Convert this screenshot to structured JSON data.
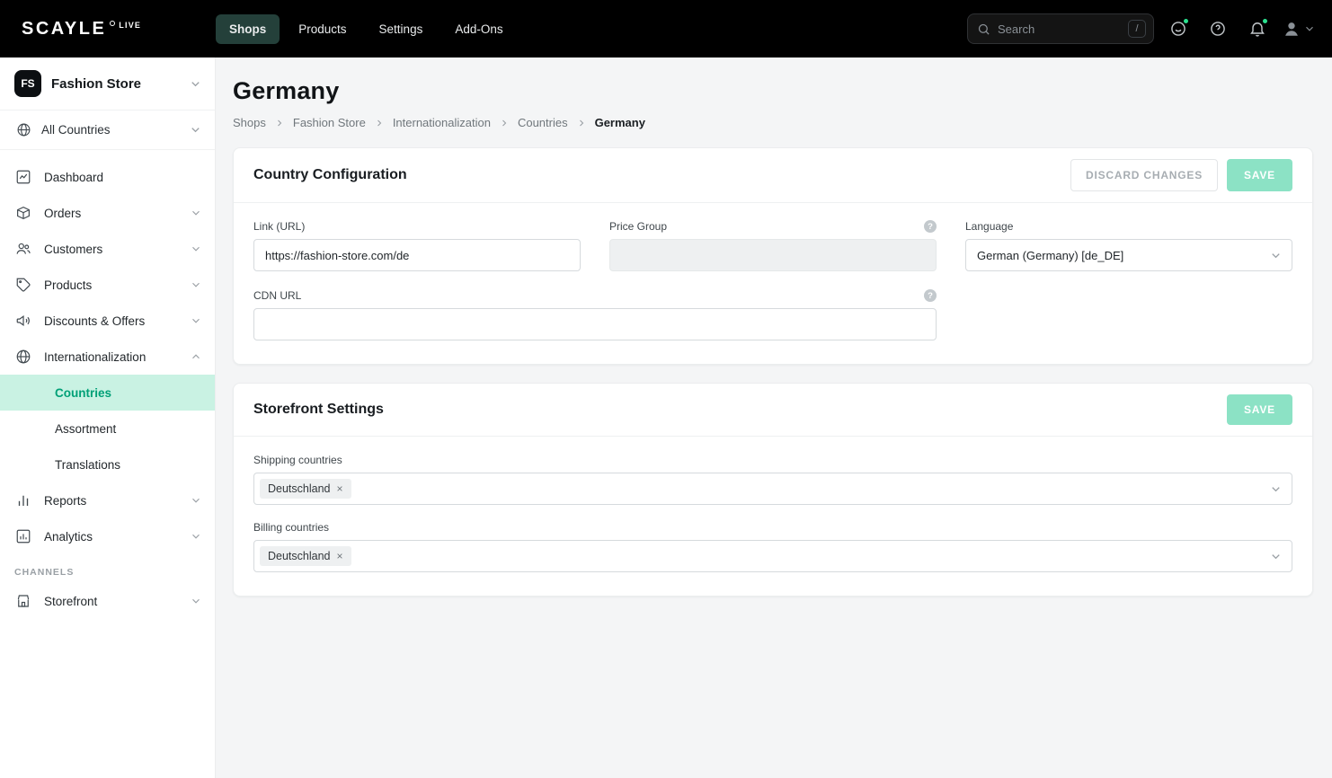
{
  "topbar": {
    "logo": "SCAYLE",
    "env_badge": "LIVE",
    "nav": [
      {
        "label": "Shops",
        "active": true
      },
      {
        "label": "Products",
        "active": false
      },
      {
        "label": "Settings",
        "active": false
      },
      {
        "label": "Add-Ons",
        "active": false
      }
    ],
    "search": {
      "placeholder": "Search",
      "shortcut": "/"
    }
  },
  "sidebar": {
    "shop": {
      "initials": "FS",
      "name": "Fashion Store"
    },
    "scope": {
      "label": "All Countries"
    },
    "items": [
      {
        "label": "Dashboard"
      },
      {
        "label": "Orders"
      },
      {
        "label": "Customers"
      },
      {
        "label": "Products"
      },
      {
        "label": "Discounts & Offers"
      },
      {
        "label": "Internationalization"
      },
      {
        "label": "Reports"
      },
      {
        "label": "Analytics"
      },
      {
        "label": "Storefront"
      }
    ],
    "intl_children": [
      {
        "label": "Countries",
        "active": true
      },
      {
        "label": "Assortment",
        "active": false
      },
      {
        "label": "Translations",
        "active": false
      }
    ],
    "channels_label": "CHANNELS"
  },
  "main": {
    "title": "Germany",
    "breadcrumb": [
      "Shops",
      "Fashion Store",
      "Internationalization",
      "Countries",
      "Germany"
    ],
    "country_config": {
      "title": "Country Configuration",
      "discard_label": "DISCARD CHANGES",
      "save_label": "SAVE",
      "fields": {
        "link_url": {
          "label": "Link (URL)",
          "value": "https://fashion-store.com/de"
        },
        "price_group": {
          "label": "Price Group",
          "value": ""
        },
        "language": {
          "label": "Language",
          "value": "German (Germany) [de_DE]"
        },
        "cdn_url": {
          "label": "CDN URL",
          "value": ""
        }
      }
    },
    "storefront_settings": {
      "title": "Storefront Settings",
      "save_label": "SAVE",
      "shipping": {
        "label": "Shipping countries",
        "chips": [
          "Deutschland"
        ]
      },
      "billing": {
        "label": "Billing countries",
        "chips": [
          "Deutschland"
        ]
      }
    }
  },
  "colors": {
    "topbar_bg": "#000000",
    "active_nav_bg": "#24403a",
    "accent_mint": "#8ce2c5",
    "active_item_bg": "#c9f2e3",
    "active_item_text": "#00a077",
    "notification_dot": "#2be08f"
  }
}
